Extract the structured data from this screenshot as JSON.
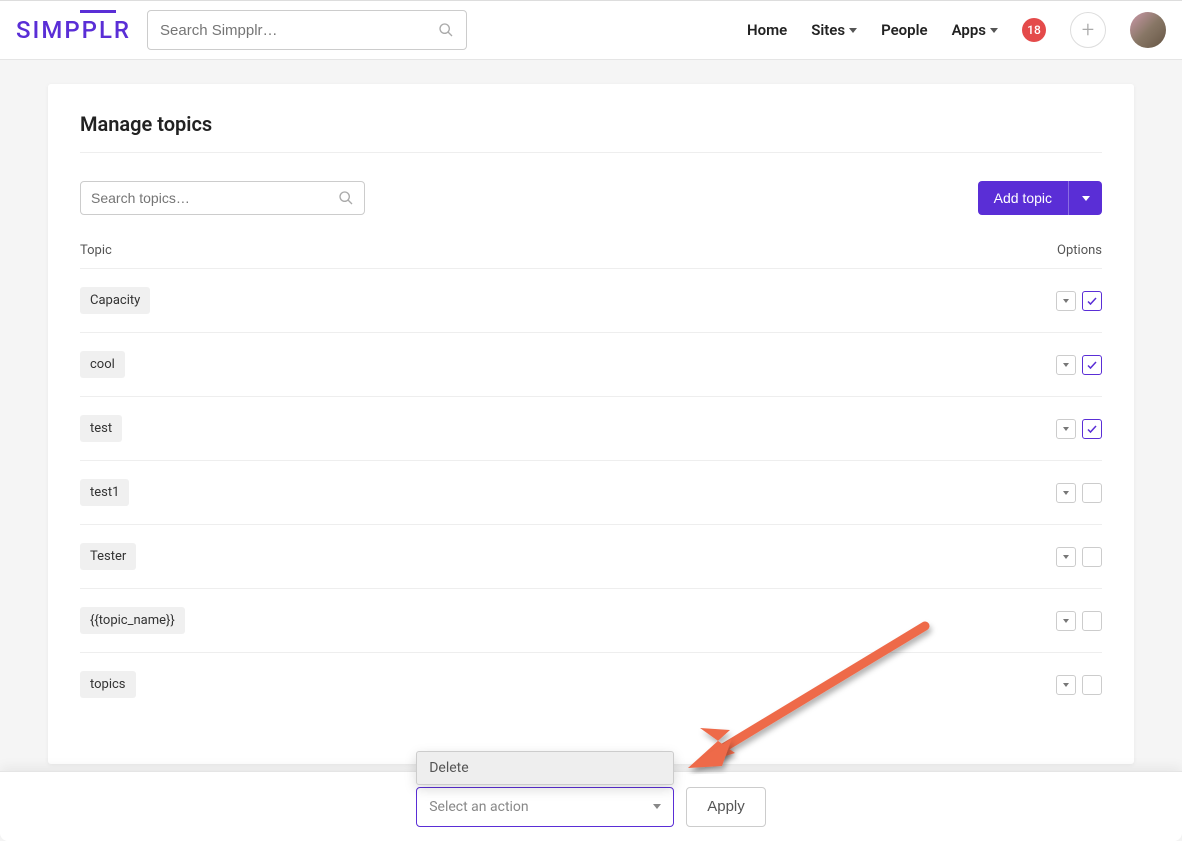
{
  "brand": "SIMPPLR",
  "search": {
    "placeholder": "Search Simpplr…"
  },
  "nav": {
    "home": "Home",
    "sites": "Sites",
    "people": "People",
    "apps": "Apps",
    "badge": "18"
  },
  "page": {
    "title": "Manage topics",
    "topic_search_placeholder": "Search topics…",
    "add_topic": "Add topic",
    "col_topic": "Topic",
    "col_options": "Options"
  },
  "topics": [
    {
      "name": "Capacity",
      "checked": true
    },
    {
      "name": "cool",
      "checked": true
    },
    {
      "name": "test",
      "checked": true
    },
    {
      "name": "test1",
      "checked": false
    },
    {
      "name": "Tester",
      "checked": false
    },
    {
      "name": "{{topic_name}}",
      "checked": false
    },
    {
      "name": "topics",
      "checked": false
    }
  ],
  "footer": {
    "dropdown_option": "Delete",
    "select_placeholder": "Select an action",
    "apply": "Apply"
  },
  "colors": {
    "accent": "#5a2ed6",
    "arrow": "#ee6a4a",
    "badge": "#e44a4a"
  }
}
